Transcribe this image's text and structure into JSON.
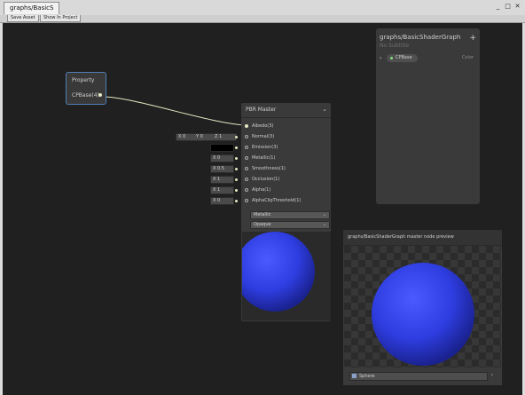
{
  "window": {
    "tab_title": "graphs/BasicS",
    "controls": [
      "_",
      "□",
      "✕"
    ]
  },
  "toolbar": {
    "save_label": "Save Asset",
    "show_in_project_label": "Show In Project"
  },
  "property_node": {
    "title": "Property",
    "output_label": "CPBase(4)"
  },
  "master_node": {
    "title": "PBR Master",
    "ports": [
      {
        "label": "Albedo(3)",
        "connected": true
      },
      {
        "label": "Normal(3)",
        "connected": false
      },
      {
        "label": "Emission(3)",
        "connected": false
      },
      {
        "label": "Metallic(1)",
        "connected": false
      },
      {
        "label": "Smoothness(1)",
        "connected": false
      },
      {
        "label": "Occlusion(1)",
        "connected": false
      },
      {
        "label": "Alpha(1)",
        "connected": false
      },
      {
        "label": "AlphaClipThreshold(1)",
        "connected": false
      }
    ],
    "workflow_option": "Metallic",
    "surface_option": "Opaque"
  },
  "inputs": {
    "normal": {
      "x": "X 0",
      "y": "Y 0",
      "z": "Z 1"
    },
    "metallic": "X 0",
    "smoothness": "X 0.5",
    "occlusion": "X 1",
    "alpha": "X 1",
    "alpha_clip": "X 0"
  },
  "blackboard": {
    "title": "graphs/BasicShaderGraph",
    "subtitle": "No Subtitle",
    "add_label": "+",
    "properties": [
      {
        "name": "CPBase",
        "type": "Color"
      }
    ]
  },
  "main_preview": {
    "title": "graphs/BasicShaderGraph master node preview",
    "mesh_field": "Sphere"
  },
  "colors": {
    "sphere": "#2e3de0",
    "edge": "#e8e8c4",
    "node_selected_border": "#4f7fb3"
  }
}
